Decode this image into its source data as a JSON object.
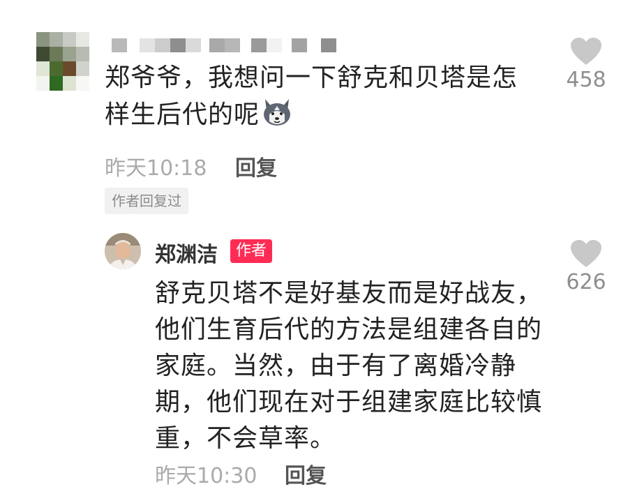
{
  "comment": {
    "text_line1": "郑爷爷，我想问一下舒克和贝塔是怎",
    "text_line2": "样生后代的呢",
    "emoji_icon": "husky-dog-emoji",
    "time": "昨天10:18",
    "reply_label": "回复",
    "author_replied_badge": "作者回复过",
    "likes": "458"
  },
  "reply": {
    "author_name": "郑渊洁",
    "author_tag": "作者",
    "lines": [
      "舒克贝塔不是好基友而是好战友，",
      "他们生育后代的方法是组建各自的",
      "家庭。当然，由于有了离婚冷静",
      "期，他们现在对于组建家庭比较慎",
      "重，不会草率。"
    ],
    "time": "昨天10:30",
    "reply_label": "回复",
    "likes": "626"
  },
  "colors": {
    "accent_red": "#fe2c55",
    "heart_gray": "#c8c8c8",
    "text_dark": "#222222",
    "text_muted": "#aaaaaa"
  }
}
